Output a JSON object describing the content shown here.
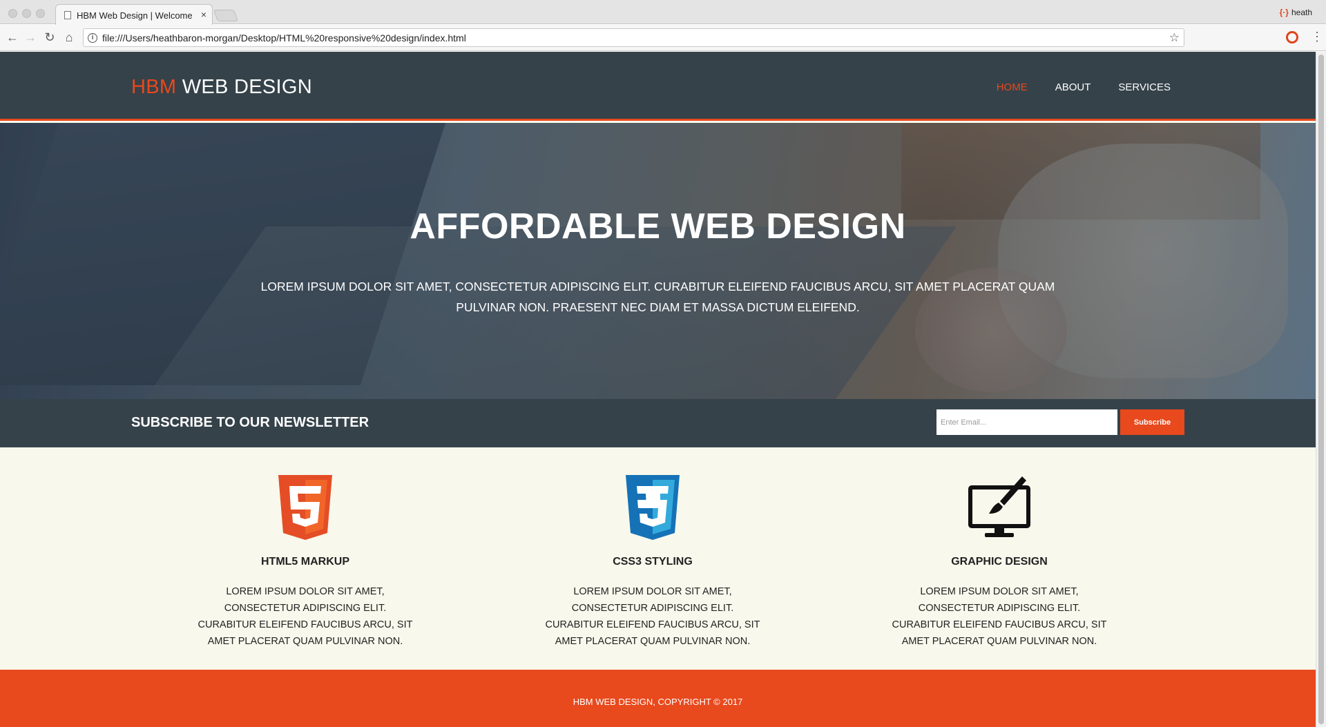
{
  "browser": {
    "tab_title": "HBM Web Design | Welcome",
    "tab_close": "×",
    "url": "file:///Users/heathbaron-morgan/Desktop/HTML%20responsive%20design/index.html",
    "profile_name": "heath"
  },
  "header": {
    "logo_highlight": "HBM",
    "logo_rest": " WEB DESIGN",
    "nav": [
      {
        "label": "HOME",
        "active": true
      },
      {
        "label": "ABOUT",
        "active": false
      },
      {
        "label": "SERVICES",
        "active": false
      }
    ]
  },
  "hero": {
    "title": "AFFORDABLE WEB DESIGN",
    "text": "LOREM IPSUM DOLOR SIT AMET, CONSECTETUR ADIPISCING ELIT. CURABITUR ELEIFEND FAUCIBUS ARCU, SIT AMET PLACERAT QUAM PULVINAR NON. PRAESENT NEC DIAM ET MASSA DICTUM ELEIFEND."
  },
  "newsletter": {
    "title": "SUBSCRIBE TO OUR NEWSLETTER",
    "placeholder": "Enter Email...",
    "button": "Subscribe"
  },
  "boxes": [
    {
      "icon": "html5-logo-icon",
      "title": "HTML5 MARKUP",
      "text": "LOREM IPSUM DOLOR SIT AMET, CONSECTETUR ADIPISCING ELIT. CURABITUR ELEIFEND FAUCIBUS ARCU, SIT AMET PLACERAT QUAM PULVINAR NON."
    },
    {
      "icon": "css3-logo-icon",
      "title": "CSS3 STYLING",
      "text": "LOREM IPSUM DOLOR SIT AMET, CONSECTETUR ADIPISCING ELIT. CURABITUR ELEIFEND FAUCIBUS ARCU, SIT AMET PLACERAT QUAM PULVINAR NON."
    },
    {
      "icon": "monitor-brush-icon",
      "title": "GRAPHIC DESIGN",
      "text": "LOREM IPSUM DOLOR SIT AMET, CONSECTETUR ADIPISCING ELIT. CURABITUR ELEIFEND FAUCIBUS ARCU, SIT AMET PLACERAT QUAM PULVINAR NON."
    }
  ],
  "footer": {
    "text": "HBM WEB DESIGN, COPYRIGHT © 2017"
  },
  "colors": {
    "accent": "#e8491d",
    "dark": "#35424a",
    "light_bg": "#f8f8ec"
  }
}
